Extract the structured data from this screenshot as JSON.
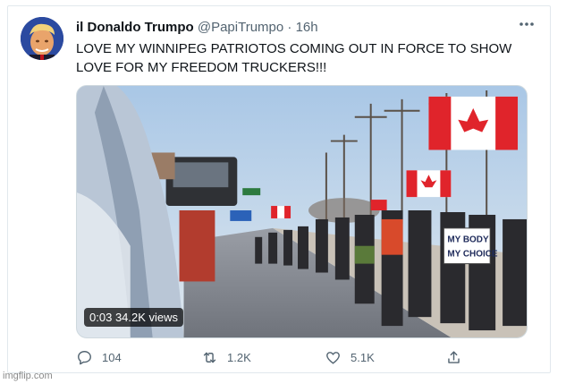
{
  "tweet": {
    "display_name": "il Donaldo Trumpo",
    "handle": "@PapiTrumpo",
    "separator": "·",
    "time": "16h",
    "text": "LOVE MY WINNIPEG PATRIOTOS COMING OUT IN FORCE TO SHOW LOVE FOR MY FREEDOM TRUCKERS!!!",
    "more_icon": "more-horizontal-icon",
    "media": {
      "type": "video",
      "video_time": "0:03",
      "views": "34.2K views",
      "sign_text_line1": "MY BODY",
      "sign_text_line2": "MY CHOICE"
    }
  },
  "actions": {
    "reply": {
      "icon": "reply-icon",
      "count": "104"
    },
    "retweet": {
      "icon": "retweet-icon",
      "count": "1.2K"
    },
    "like": {
      "icon": "heart-icon",
      "count": "5.1K"
    },
    "share": {
      "icon": "share-icon"
    }
  },
  "watermark": "imgflip.com",
  "colors": {
    "text": "#0f1419",
    "secondary": "#536471",
    "border": "#e1e8ed",
    "flag_red": "#e0242b"
  }
}
